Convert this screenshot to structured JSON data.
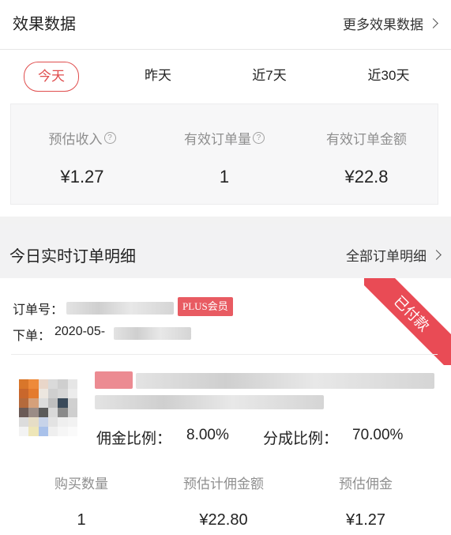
{
  "header": {
    "title": "效果数据",
    "more_label": "更多效果数据"
  },
  "tabs": [
    {
      "label": "今天",
      "active": true
    },
    {
      "label": "昨天",
      "active": false
    },
    {
      "label": "近7天",
      "active": false
    },
    {
      "label": "近30天",
      "active": false
    }
  ],
  "stats": [
    {
      "label": "预估收入",
      "value": "¥1.27",
      "help": true
    },
    {
      "label": "有效订单量",
      "value": "1",
      "help": true
    },
    {
      "label": "有效订单金额",
      "value": "¥22.8",
      "help": false
    }
  ],
  "section": {
    "title": "今日实时订单明细",
    "more_label": "全部订单明细"
  },
  "order": {
    "status": "已付款",
    "order_no_label": "订单号：",
    "member_badge": "PLUS会员",
    "date_label": "下单：",
    "date_value": "2020-05-",
    "commission_rate_label": "佣金比例：",
    "commission_rate": "8.00%",
    "share_rate_label": "分成比例：",
    "share_rate": "70.00%",
    "metrics": [
      {
        "label": "购买数量",
        "value": "1"
      },
      {
        "label": "预估计佣金额",
        "value": "¥22.80"
      },
      {
        "label": "预估佣金",
        "value": "¥1.27"
      }
    ]
  },
  "colors": {
    "accent": "#e04e4e",
    "badge": "#e85b62",
    "ribbon": "#e94b55"
  },
  "icons": {
    "help": "question-circle-icon",
    "more": "chevron-right-icon"
  }
}
